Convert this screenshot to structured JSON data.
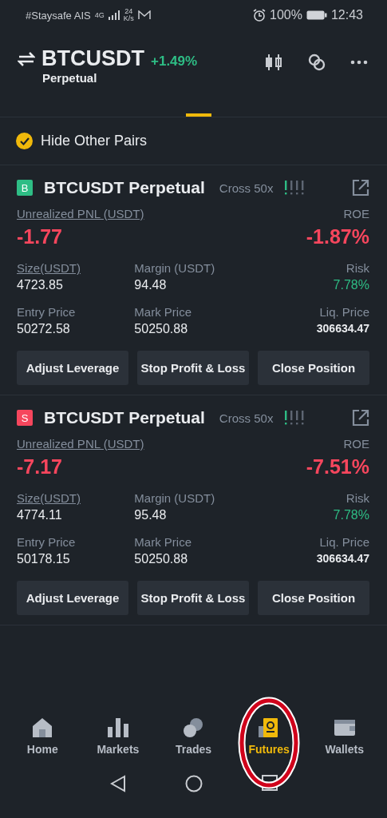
{
  "status_bar": {
    "carrier": "#Staysafe AIS",
    "network": "4G",
    "speed_value": "24",
    "speed_unit": "K/s",
    "battery": "100%",
    "time": "12:43"
  },
  "header": {
    "symbol": "BTCUSDT",
    "change": "+1.49%",
    "subtitle": "Perpetual"
  },
  "filter": {
    "label": "Hide Other Pairs",
    "checked": true
  },
  "positions": [
    {
      "side": {
        "label": "B",
        "color": "#2ebd85"
      },
      "title": "BTCUSDT Perpetual",
      "margin_mode": "Cross 50x",
      "risk_meter": {
        "level": 0.25
      },
      "pnl_label": "Unrealized PNL (USDT)",
      "pnl": "-1.77",
      "roe_label": "ROE",
      "roe": "-1.87%",
      "stats": [
        {
          "label": "Size(USDT)",
          "value": "4723.85",
          "underlined": true
        },
        {
          "label": "Margin (USDT)",
          "value": "94.48",
          "underlined": false
        },
        {
          "label": "Risk",
          "value": "7.78%",
          "underlined": false
        },
        {
          "label": "Entry Price",
          "value": "50272.58",
          "underlined": false
        },
        {
          "label": "Mark Price",
          "value": "50250.88",
          "underlined": false
        },
        {
          "label": "Liq. Price",
          "value": "306634.47",
          "underlined": false
        }
      ],
      "buttons": [
        "Adjust Leverage",
        "Stop Profit & Loss",
        "Close Position"
      ]
    },
    {
      "side": {
        "label": "S",
        "color": "#f6465d"
      },
      "title": "BTCUSDT Perpetual",
      "margin_mode": "Cross 50x",
      "risk_meter": {
        "level": 0.25
      },
      "pnl_label": "Unrealized PNL (USDT)",
      "pnl": "-7.17",
      "roe_label": "ROE",
      "roe": "-7.51%",
      "stats": [
        {
          "label": "Size(USDT)",
          "value": "4774.11",
          "underlined": true
        },
        {
          "label": "Margin (USDT)",
          "value": "95.48",
          "underlined": false
        },
        {
          "label": "Risk",
          "value": "7.78%",
          "underlined": false
        },
        {
          "label": "Entry Price",
          "value": "50178.15",
          "underlined": false
        },
        {
          "label": "Mark Price",
          "value": "50250.88",
          "underlined": false
        },
        {
          "label": "Liq. Price",
          "value": "306634.47",
          "underlined": false
        }
      ],
      "buttons": [
        "Adjust Leverage",
        "Stop Profit & Loss",
        "Close Position"
      ]
    }
  ],
  "bottom_nav": [
    {
      "kind": "home",
      "label": "Home",
      "selected": false,
      "circled": false
    },
    {
      "kind": "markets",
      "label": "Markets",
      "selected": false,
      "circled": false
    },
    {
      "kind": "trades",
      "label": "Trades",
      "selected": false,
      "circled": false
    },
    {
      "kind": "futures",
      "label": "Futures",
      "selected": true,
      "circled": true
    },
    {
      "kind": "wallets",
      "label": "Wallets",
      "selected": false,
      "circled": false
    }
  ]
}
